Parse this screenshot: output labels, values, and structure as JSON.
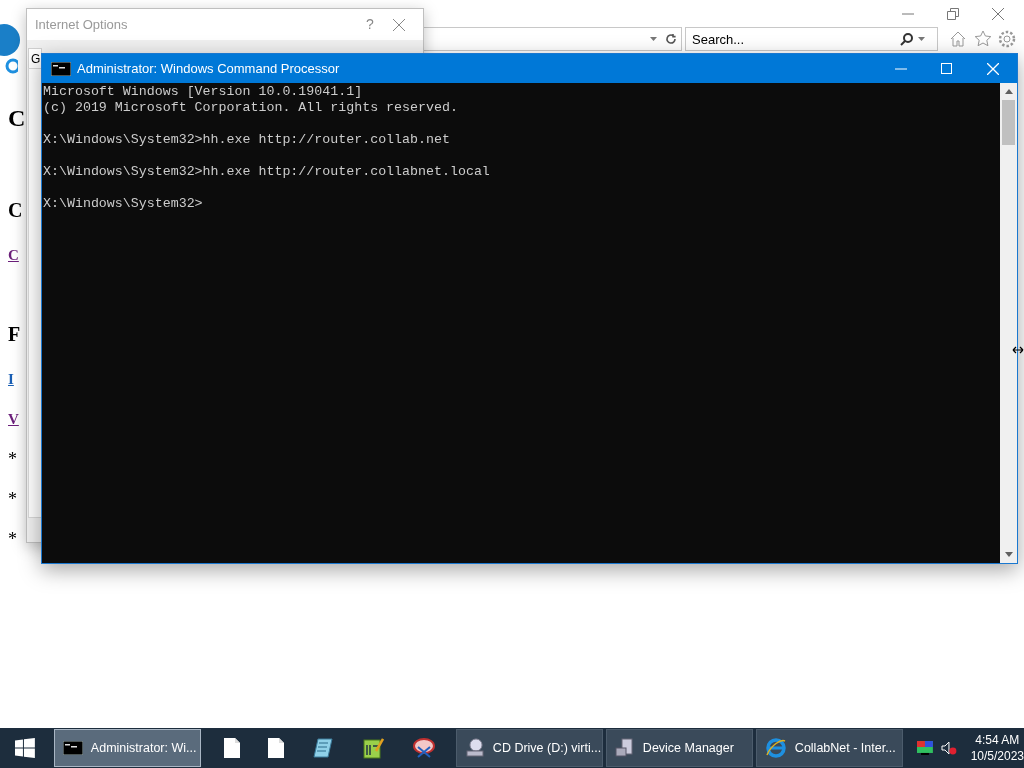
{
  "browser": {
    "search": {
      "placeholder": "Search..."
    },
    "page": [
      {
        "kind": "heading1",
        "text": "C"
      },
      {
        "kind": "heading2",
        "text": "C"
      },
      {
        "kind": "link",
        "text": "C",
        "visited": true
      },
      {
        "kind": "heading2",
        "text": "F"
      },
      {
        "kind": "link",
        "text": "I",
        "visited": false
      },
      {
        "kind": "link",
        "text": "V",
        "visited": true
      },
      {
        "kind": "bullet",
        "text": "*"
      },
      {
        "kind": "bullet",
        "text": "*"
      },
      {
        "kind": "bullet",
        "text": "*"
      }
    ]
  },
  "internet_options": {
    "title": "Internet Options",
    "help": "?",
    "tabs": [
      {
        "label": "G"
      }
    ]
  },
  "cmd": {
    "title": "Administrator: Windows Command Processor",
    "blocks": [
      [
        "Microsoft Windows [Version 10.0.19041.1]",
        "(c) 2019 Microsoft Corporation. All rights reserved."
      ],
      [
        "X:\\Windows\\System32>hh.exe http://router.collab.net"
      ],
      [
        "X:\\Windows\\System32>hh.exe http://router.collabnet.local"
      ],
      [
        "X:\\Windows\\System32>"
      ]
    ]
  },
  "taskbar": {
    "buttons": [
      {
        "label": "Administrator: Wi...",
        "selected": true
      },
      {
        "label": "CD Drive (D:) virti...",
        "selected": false
      },
      {
        "label": "Device Manager",
        "selected": false
      },
      {
        "label": "CollabNet - Inter...",
        "selected": false
      }
    ],
    "clock": {
      "time": "4:54 AM",
      "date": "10/5/2023"
    }
  }
}
